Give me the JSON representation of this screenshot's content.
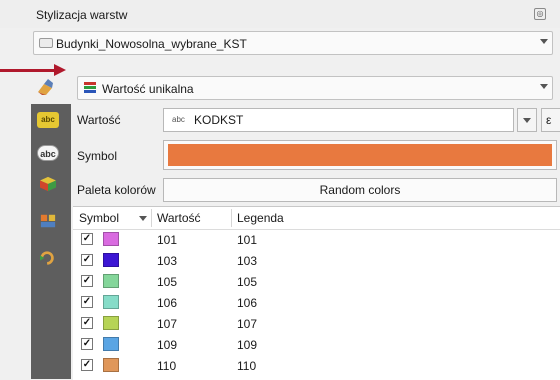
{
  "panel": {
    "title": "Stylizacja warstw",
    "layer_name": "Budynki_Nowosolna_wybrane_KST",
    "renderer": "Wartość unikalna"
  },
  "form": {
    "value_label": "Wartość",
    "value_type_badge": "abc",
    "value_field": "KODKST",
    "expression_button": "ε",
    "symbol_label": "Symbol",
    "symbol_color": "#e8793f",
    "ramp_label": "Paleta kolorów",
    "ramp_value": "Random colors"
  },
  "side_tabs": {
    "labels_tab": "abc",
    "masks_tab": "abc"
  },
  "table": {
    "headers": [
      "Symbol",
      "Wartość",
      "Legenda"
    ],
    "rows": [
      {
        "checked": "✓",
        "color": "#d96be0",
        "value": "101",
        "legend": "101"
      },
      {
        "checked": "✓",
        "color": "#3c16d4",
        "value": "103",
        "legend": "103"
      },
      {
        "checked": "✓",
        "color": "#84d69a",
        "value": "105",
        "legend": "105"
      },
      {
        "checked": "✓",
        "color": "#86dcc8",
        "value": "106",
        "legend": "106"
      },
      {
        "checked": "✓",
        "color": "#b6d456",
        "value": "107",
        "legend": "107"
      },
      {
        "checked": "✓",
        "color": "#5aa5e4",
        "value": "109",
        "legend": "109"
      },
      {
        "checked": "✓",
        "color": "#e0975a",
        "value": "110",
        "legend": "110"
      }
    ]
  },
  "colors": {
    "annotation_arrow": "#b0192c",
    "side_strip": "#5e5e5e"
  }
}
